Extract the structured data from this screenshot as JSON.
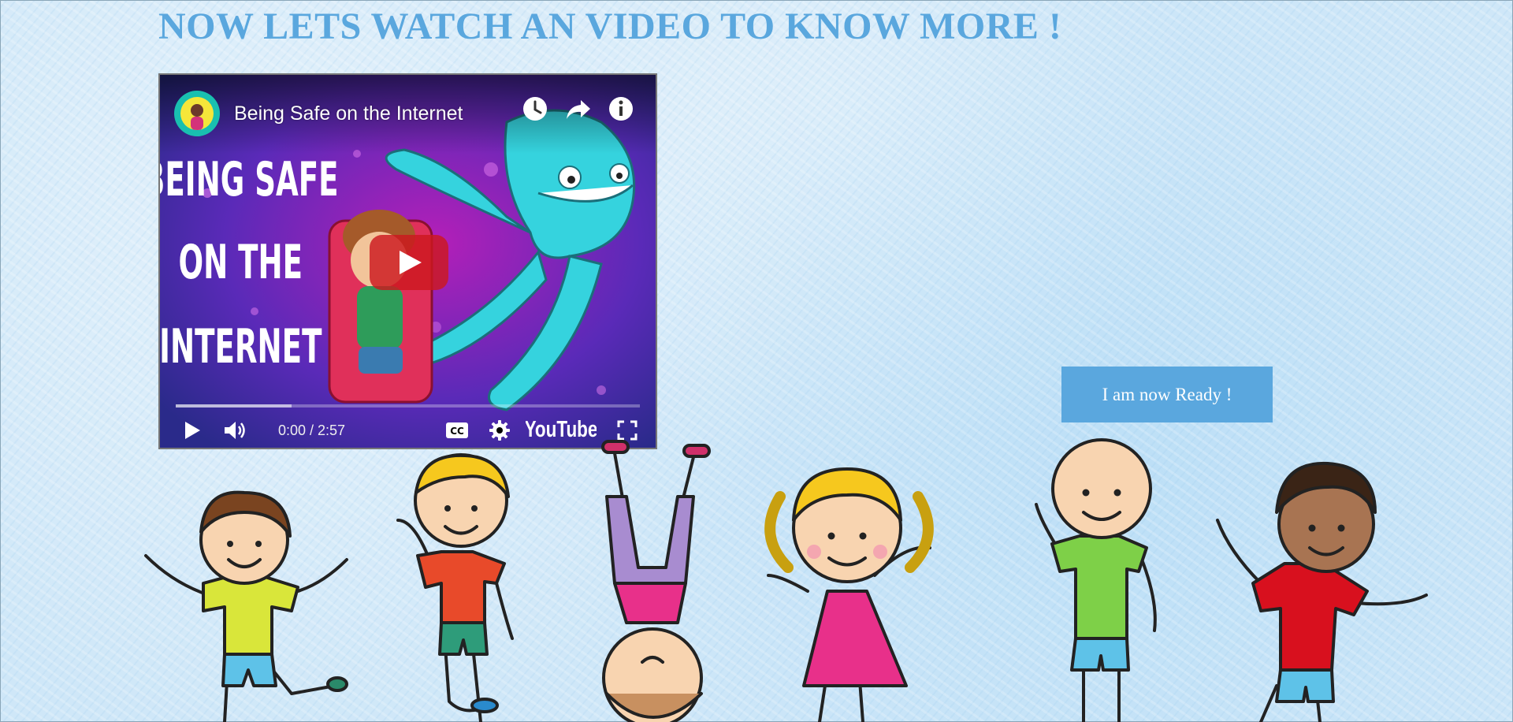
{
  "page": {
    "heading": "NOW LETS WATCH AN VIDEO TO KNOW MORE !",
    "heading_color": "#5aa7de",
    "background_color": "#cfe7f8"
  },
  "video": {
    "title": "Being Safe on the Internet",
    "thumbnail_text": [
      "BEING SAFE",
      "ON THE",
      "INTERNET"
    ],
    "time": "0:00 / 2:57",
    "brand": "YouTube",
    "progress_buffered": 0.25,
    "icons": [
      "channel-avatar",
      "watch-later-icon",
      "share-icon",
      "info-icon",
      "play-icon",
      "volume-icon",
      "captions-icon",
      "settings-icon",
      "youtube-logo",
      "fullscreen-icon"
    ],
    "play_button_color": "#cc181e"
  },
  "actions": {
    "ready_label": "I am now Ready !",
    "ready_color": "#5aa7de"
  },
  "illustration": {
    "name": "kids-playing-illustration"
  }
}
